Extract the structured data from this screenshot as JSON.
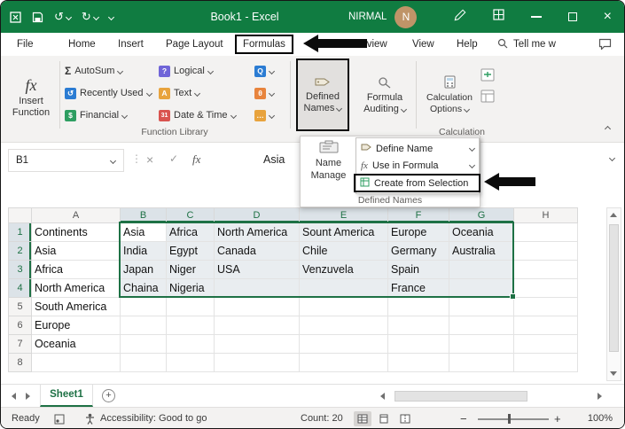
{
  "window": {
    "title": "Book1 - Excel",
    "user": "NIRMAL",
    "avatar": "N"
  },
  "tabs": {
    "file": "File",
    "home": "Home",
    "insert": "Insert",
    "page_layout": "Page Layout",
    "formulas": "Formulas",
    "review": "Review",
    "view": "View",
    "help": "Help",
    "tell_me": "Tell me w"
  },
  "ribbon": {
    "insert_function_line1": "Insert",
    "insert_function_line2": "Function",
    "function_library_label": "Function Library",
    "autosum": "AutoSum",
    "recently_used": "Recently Used",
    "financial": "Financial",
    "logical": "Logical",
    "text": "Text",
    "date_time": "Date & Time",
    "defined_names_line1": "Defined",
    "defined_names_line2": "Names",
    "formula_auditing_line1": "Formula",
    "formula_auditing_line2": "Auditing",
    "calc_options_line1": "Calculation",
    "calc_options_line2": "Options",
    "calculation_label": "Calculation"
  },
  "dropdown": {
    "name_manager_line1": "Name",
    "name_manager_line2": "Manage",
    "define_name": "Define Name",
    "use_in_formula": "Use in Formula",
    "create_from_selection": "Create from Selection",
    "group_label": "Defined Names"
  },
  "formula_bar": {
    "name_box": "B1",
    "content": "Asia"
  },
  "grid": {
    "col_headers": [
      "A",
      "B",
      "C",
      "D",
      "E",
      "F",
      "G",
      "H"
    ],
    "row_headers": [
      "1",
      "2",
      "3",
      "4",
      "5",
      "6",
      "7",
      "8"
    ],
    "rows": [
      [
        "Continents",
        "Asia",
        "Africa",
        "North America",
        "Sount America",
        "Europe",
        "Oceania",
        ""
      ],
      [
        "Asia",
        "India",
        "Egypt",
        "Canada",
        "Chile",
        "Germany",
        "Australia",
        ""
      ],
      [
        "Africa",
        "Japan",
        "Niger",
        "USA",
        "Venzuvela",
        "Spain",
        "",
        ""
      ],
      [
        "North America",
        "Chaina",
        "Nigeria",
        "",
        "",
        "France",
        "",
        ""
      ],
      [
        "South America",
        "",
        "",
        "",
        "",
        "",
        "",
        ""
      ],
      [
        "Europe",
        "",
        "",
        "",
        "",
        "",
        "",
        ""
      ],
      [
        "Oceania",
        "",
        "",
        "",
        "",
        "",
        "",
        ""
      ],
      [
        "",
        "",
        "",
        "",
        "",
        "",
        "",
        ""
      ]
    ]
  },
  "sheet": {
    "name": "Sheet1"
  },
  "status": {
    "ready": "Ready",
    "accessibility": "Accessibility: Good to go",
    "count": "Count: 20",
    "zoom": "100%"
  },
  "icons": {
    "autosum_glyph": "Σ",
    "fx": "fx",
    "cancel": "×",
    "enter": "✓",
    "dots": "⋮",
    "undo": "↺",
    "redo": "↻",
    "logical_glyph": "?",
    "text_glyph": "A",
    "lookup_glyph": "Q",
    "math_glyph": "θ",
    "more_glyph": "…",
    "financial_glyph": "$",
    "datetime_glyph": "31",
    "recent_glyph": "↺",
    "minus": "−",
    "plus": "+",
    "close": "×"
  },
  "colors": {
    "titlebar_green": "#107c41",
    "selection_green": "#1e7145"
  }
}
